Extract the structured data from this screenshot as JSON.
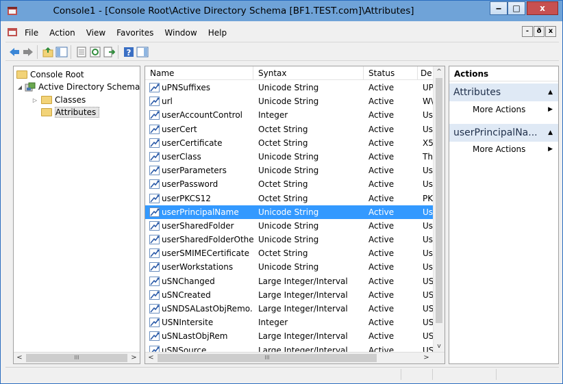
{
  "window": {
    "title": "Console1 - [Console Root\\Active Directory Schema [BF1.TEST.com]\\Attributes]",
    "min_glyph": "‒",
    "max_glyph": "□",
    "close_glyph": "x"
  },
  "menubar": {
    "items": [
      "File",
      "Action",
      "View",
      "Favorites",
      "Window",
      "Help"
    ],
    "mdi": [
      "-",
      "ð",
      "x"
    ]
  },
  "tree": {
    "root": "Console Root",
    "schema": "Active Directory Schema",
    "classes": "Classes",
    "attributes": "Attributes",
    "expand_open": "◢",
    "expand_closed": "▷"
  },
  "list": {
    "columns": [
      "Name",
      "Syntax",
      "Status",
      "De"
    ],
    "sort_glyph": "^",
    "rows": [
      {
        "name": "uPNSuffixes",
        "syntax": "Unicode String",
        "status": "Active",
        "desc": "UP"
      },
      {
        "name": "url",
        "syntax": "Unicode String",
        "status": "Active",
        "desc": "W\\"
      },
      {
        "name": "userAccountControl",
        "syntax": "Integer",
        "status": "Active",
        "desc": "Us"
      },
      {
        "name": "userCert",
        "syntax": "Octet String",
        "status": "Active",
        "desc": "Us"
      },
      {
        "name": "userCertificate",
        "syntax": "Octet String",
        "status": "Active",
        "desc": "X5"
      },
      {
        "name": "userClass",
        "syntax": "Unicode String",
        "status": "Active",
        "desc": "Th"
      },
      {
        "name": "userParameters",
        "syntax": "Unicode String",
        "status": "Active",
        "desc": "Us"
      },
      {
        "name": "userPassword",
        "syntax": "Octet String",
        "status": "Active",
        "desc": "Us"
      },
      {
        "name": "userPKCS12",
        "syntax": "Octet String",
        "status": "Active",
        "desc": "PK"
      },
      {
        "name": "userPrincipalName",
        "syntax": "Unicode String",
        "status": "Active",
        "desc": "Us",
        "selected": true
      },
      {
        "name": "userSharedFolder",
        "syntax": "Unicode String",
        "status": "Active",
        "desc": "Us"
      },
      {
        "name": "userSharedFolderOther",
        "syntax": "Unicode String",
        "status": "Active",
        "desc": "Us"
      },
      {
        "name": "userSMIMECertificate",
        "syntax": "Octet String",
        "status": "Active",
        "desc": "Us"
      },
      {
        "name": "userWorkstations",
        "syntax": "Unicode String",
        "status": "Active",
        "desc": "Us"
      },
      {
        "name": "uSNChanged",
        "syntax": "Large Integer/Interval",
        "status": "Active",
        "desc": "US"
      },
      {
        "name": "uSNCreated",
        "syntax": "Large Integer/Interval",
        "status": "Active",
        "desc": "US"
      },
      {
        "name": "uSNDSALastObjRemo...",
        "syntax": "Large Integer/Interval",
        "status": "Active",
        "desc": "US"
      },
      {
        "name": "USNIntersite",
        "syntax": "Integer",
        "status": "Active",
        "desc": "US"
      },
      {
        "name": "uSNLastObjRem",
        "syntax": "Large Integer/Interval",
        "status": "Active",
        "desc": "US"
      },
      {
        "name": "uSNSource",
        "syntax": "Large Integer/Interval",
        "status": "Active",
        "desc": "US"
      }
    ]
  },
  "actions": {
    "header": "Actions",
    "sections": [
      {
        "title": "Attributes",
        "item": "More Actions"
      },
      {
        "title": "userPrincipalNa...",
        "item": "More Actions"
      }
    ],
    "collapse_glyph": "▲",
    "arrow_glyph": "▶"
  },
  "scroll": {
    "left": "<",
    "right": ">",
    "grip": "III",
    "up": "^",
    "down": "v"
  },
  "colors": {
    "titlebar": "#6fa3d8",
    "selection": "#3399ff",
    "action_section": "#dfe9f5"
  }
}
